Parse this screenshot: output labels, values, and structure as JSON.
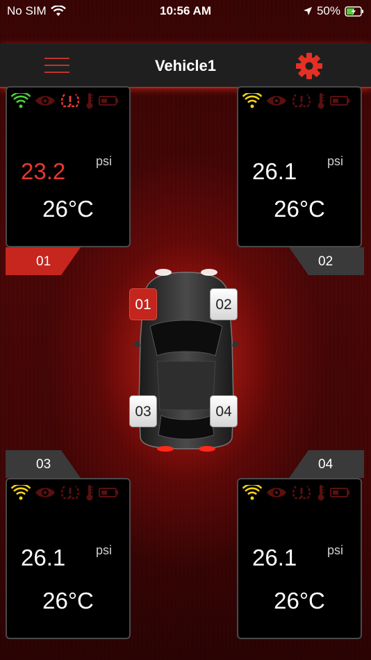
{
  "status": {
    "carrier": "No SIM",
    "time": "10:56 AM",
    "battery": "50%"
  },
  "header": {
    "title": "Vehicle1"
  },
  "colors": {
    "alert": "#e53a31",
    "signal_green": "#4cd137",
    "signal_yellow": "#f2d21a",
    "dim": "#5a1010"
  },
  "sensors": [
    {
      "id": "01",
      "pressure": "23.2",
      "unit": "psi",
      "temperature": "26°C",
      "signal": "green",
      "alert": true
    },
    {
      "id": "02",
      "pressure": "26.1",
      "unit": "psi",
      "temperature": "26°C",
      "signal": "yellow",
      "alert": false
    },
    {
      "id": "03",
      "pressure": "26.1",
      "unit": "psi",
      "temperature": "26°C",
      "signal": "yellow",
      "alert": false
    },
    {
      "id": "04",
      "pressure": "26.1",
      "unit": "psi",
      "temperature": "26°C",
      "signal": "yellow",
      "alert": false
    }
  ],
  "car": {
    "wheels": [
      "01",
      "02",
      "03",
      "04"
    ],
    "active_wheel": "01"
  },
  "icon_names": [
    "wifi-signal-icon",
    "eye-icon",
    "tire-pressure-warning-icon",
    "thermometer-icon",
    "battery-icon"
  ]
}
